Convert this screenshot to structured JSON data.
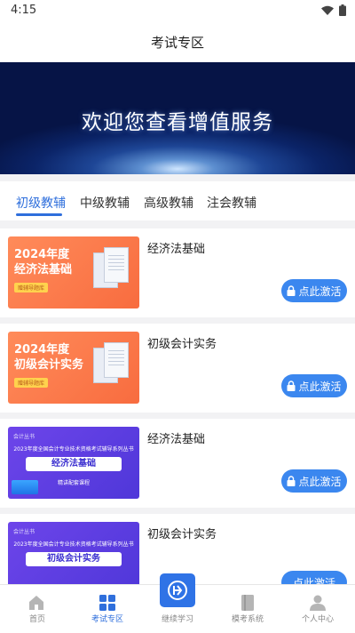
{
  "status": {
    "time": "4:15"
  },
  "header": {
    "title": "考试专区"
  },
  "banner": {
    "text": "欢迎您查看增值服务"
  },
  "tabs": [
    {
      "label": "初级教辅",
      "active": true
    },
    {
      "label": "中级教辅",
      "active": false
    },
    {
      "label": "高级教辅",
      "active": false
    },
    {
      "label": "注会教辅",
      "active": false
    }
  ],
  "courses": [
    {
      "title": "经济法基础",
      "thumb": {
        "year": "2024年度",
        "name": "经济法基础",
        "tag": "赠辅导题库"
      },
      "button": "点此激活"
    },
    {
      "title": "初级会计实务",
      "thumb": {
        "year": "2024年度",
        "name": "初级会计实务",
        "tag": "赠辅导题库"
      },
      "button": "点此激活"
    },
    {
      "title": "经济法基础",
      "thumb": {
        "top": "会计丛书",
        "line": "2023年度全国会计专业技术资格考试辅导系列丛书",
        "box": "经济法基础",
        "tag": "精讲配套课程"
      },
      "button": "点此激活"
    },
    {
      "title": "初级会计实务",
      "thumb": {
        "top": "会计丛书",
        "line": "2023年度全国会计专业技术资格考试辅导系列丛书",
        "box": "初级会计实务"
      },
      "button": "点此激活"
    }
  ],
  "bottom_nav": [
    {
      "label": "首页",
      "icon": "home-icon",
      "active": false
    },
    {
      "label": "考试专区",
      "icon": "grid-icon",
      "active": true
    },
    {
      "label": "继续学习",
      "icon": "continue-learning-icon",
      "active": false
    },
    {
      "label": "模考系统",
      "icon": "book-icon",
      "active": false
    },
    {
      "label": "个人中心",
      "icon": "user-icon",
      "active": false
    }
  ],
  "colors": {
    "accent": "#2f6fdc",
    "button": "#3b87ef"
  }
}
